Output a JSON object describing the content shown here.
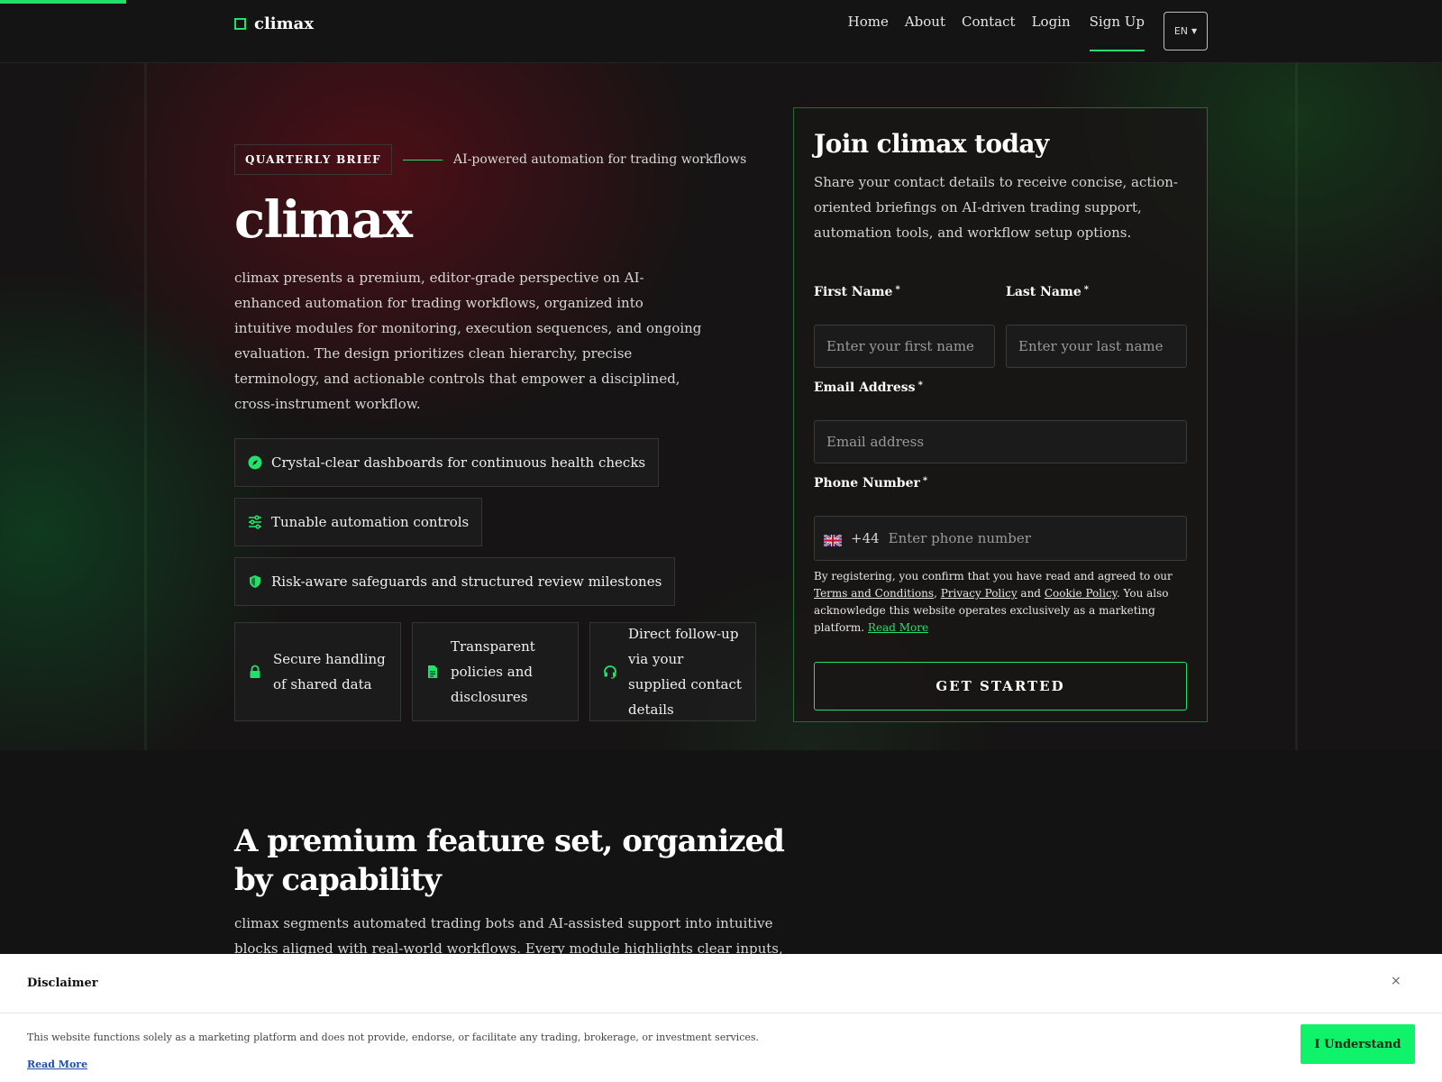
{
  "header": {
    "logo": "climax",
    "nav": [
      "Home",
      "About",
      "Contact",
      "Login",
      "Sign Up"
    ],
    "lang": "EN"
  },
  "hero": {
    "eyebrow": "QUARTERLY BRIEF",
    "eyebrow_sub": "AI-powered automation for trading workflows",
    "title": "climax",
    "description": "climax presents a premium, editor-grade perspective on AI-enhanced automation for trading workflows, organized into intuitive modules for monitoring, execution sequences, and ongoing evaluation. The design prioritizes clean hierarchy, precise terminology, and actionable controls that empower a disciplined, cross-instrument workflow.",
    "pills": [
      {
        "icon": "compass-icon",
        "label": "Crystal-clear dashboards for continuous health checks"
      },
      {
        "icon": "sliders-icon",
        "label": "Tunable automation controls"
      },
      {
        "icon": "shield-icon",
        "label": "Risk-aware safeguards and structured review milestones"
      }
    ],
    "cards": [
      {
        "icon": "lock-icon",
        "label": "Secure handling of shared data"
      },
      {
        "icon": "document-icon",
        "label": "Transparent policies and disclosures"
      },
      {
        "icon": "headset-icon",
        "label": "Direct follow-up via your supplied contact details"
      }
    ]
  },
  "form": {
    "title": "Join climax today",
    "description": "Share your contact details to receive concise, action-oriented briefings on AI-driven trading support, automation tools, and workflow setup options.",
    "first_name_label": "First Name",
    "first_name_placeholder": "Enter your first name",
    "last_name_label": "Last Name",
    "last_name_placeholder": "Enter your last name",
    "email_label": "Email Address",
    "email_placeholder": "Email address",
    "phone_label": "Phone Number",
    "dial_code": "+44",
    "phone_placeholder": "Enter phone number",
    "required_mark": "*",
    "legal_prefix": "By registering, you confirm that you have read and agreed to our ",
    "terms": "Terms and Conditions",
    "comma": ", ",
    "privacy": "Privacy Policy",
    "and": " and ",
    "cookie": "Cookie Policy",
    "legal_suffix": ". You also acknowledge this website operates exclusively as a marketing platform. ",
    "read_more": "Read More",
    "cta": "GET STARTED"
  },
  "features": {
    "title": "A premium feature set, organized by capability",
    "description": "climax segments automated trading bots and AI-assisted support into intuitive blocks aligned with real-world workflows. Every module highlights clear inputs, repeatable processes, and"
  },
  "disclaimer": {
    "title": "Disclaimer",
    "close": "×",
    "text": "This website functions solely as a marketing platform and does not provide, endorse, or facilitate any trading, brokerage, or investment services.",
    "read_more": "Read More",
    "button": "I Understand"
  },
  "colors": {
    "accent": "#22e06a",
    "background": "#131313",
    "disclaimer_button": "#10f26a"
  }
}
